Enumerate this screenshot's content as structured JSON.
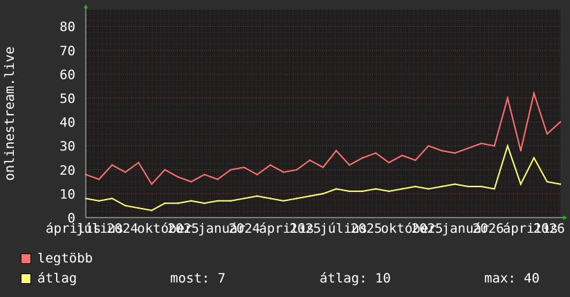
{
  "chart_data": {
    "type": "line",
    "ylabel": "onlinestream.live",
    "ylim": [
      0,
      87
    ],
    "yticks": [
      0,
      10,
      20,
      30,
      40,
      50,
      60,
      70,
      80
    ],
    "x_tick_labels": [
      "április",
      "július",
      "2024",
      "október",
      "2025",
      "január",
      "2024",
      "április",
      "2025",
      "július",
      "2025",
      "október",
      "2025",
      "január",
      "2026",
      "április",
      "2026"
    ],
    "x_dates": [
      "2023-04",
      "2023-05",
      "2023-06",
      "2023-07",
      "2023-08",
      "2023-09",
      "2023-10",
      "2023-11",
      "2023-12",
      "2024-01",
      "2024-02",
      "2024-03",
      "2024-04",
      "2024-05",
      "2024-06",
      "2024-07",
      "2024-08",
      "2024-09",
      "2024-10",
      "2024-11",
      "2024-12",
      "2025-01",
      "2025-02",
      "2025-03",
      "2025-04",
      "2025-05",
      "2025-06",
      "2025-07",
      "2025-08",
      "2025-09",
      "2025-10",
      "2025-11",
      "2025-12",
      "2026-01",
      "2026-02",
      "2026-03",
      "2026-04"
    ],
    "series": [
      {
        "name": "legtöbb",
        "color": "#ff7070",
        "values": [
          18,
          16,
          22,
          19,
          23,
          14,
          20,
          17,
          15,
          18,
          16,
          20,
          21,
          18,
          22,
          19,
          20,
          24,
          21,
          28,
          22,
          25,
          27,
          23,
          26,
          24,
          30,
          28,
          27,
          29,
          31,
          30,
          50,
          28,
          52,
          35,
          40
        ]
      },
      {
        "name": "átlag",
        "color": "#ffff70",
        "values": [
          8,
          7,
          8,
          5,
          4,
          3,
          6,
          6,
          7,
          6,
          7,
          7,
          8,
          9,
          8,
          7,
          8,
          9,
          10,
          12,
          11,
          11,
          12,
          11,
          12,
          13,
          12,
          13,
          14,
          13,
          13,
          12,
          30,
          14,
          25,
          15,
          14
        ]
      }
    ],
    "grid": true
  },
  "legend": {
    "items": [
      {
        "label": "legtöbb",
        "color": "#ff7070"
      },
      {
        "label": "átlag",
        "color": "#ffff70"
      }
    ],
    "stats": {
      "now": "most: 7",
      "avg": "átlag: 10",
      "max": "max: 40"
    }
  }
}
